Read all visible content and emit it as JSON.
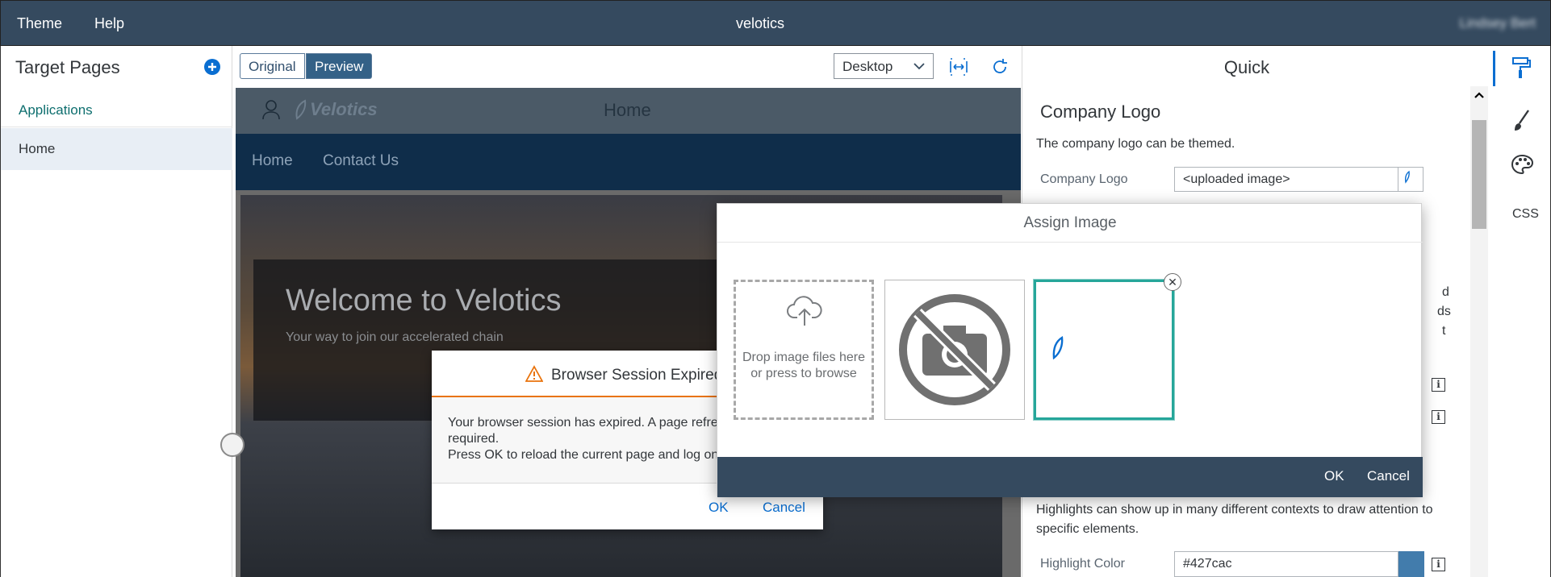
{
  "shell": {
    "menu": [
      "Theme",
      "Help"
    ],
    "title": "velotics",
    "user": "Lindsey Bert"
  },
  "left_panel": {
    "title": "Target Pages",
    "items": [
      {
        "label": "Applications"
      },
      {
        "label": "Home"
      }
    ]
  },
  "toolbar": {
    "original_label": "Original",
    "preview_label": "Preview",
    "device": "Desktop"
  },
  "preview": {
    "header_title": "Home",
    "logo_text": "Velotics",
    "nav": [
      "Home",
      "Contact Us"
    ],
    "hero_title": "Welcome to Velotics",
    "hero_subtitle": "Your way to join our accelerated chain"
  },
  "session_dialog": {
    "title": "Browser Session Expired",
    "body_line1": "Your browser session has expired. A page refresh is",
    "body_line2": "required.",
    "body_line3": "Press OK to reload the current page and log on again.",
    "ok": "OK",
    "cancel": "Cancel"
  },
  "right_panel": {
    "title": "Quick",
    "section": "Company Logo",
    "description": "The company logo can be themed.",
    "logo_label": "Company Logo",
    "logo_value": "<uploaded image>",
    "fragments": [
      "d",
      "ds",
      "t"
    ],
    "highlight_desc": "Highlights can show up in many different contexts to draw attention to specific elements.",
    "highlight_label": "Highlight Color",
    "highlight_value": "#427cac",
    "highlight_color": "#427cac"
  },
  "rail": {
    "css_label": "CSS"
  },
  "assign_dialog": {
    "title": "Assign Image",
    "upload_text": "Drop image files here or press to browse",
    "ok": "OK",
    "cancel": "Cancel"
  }
}
